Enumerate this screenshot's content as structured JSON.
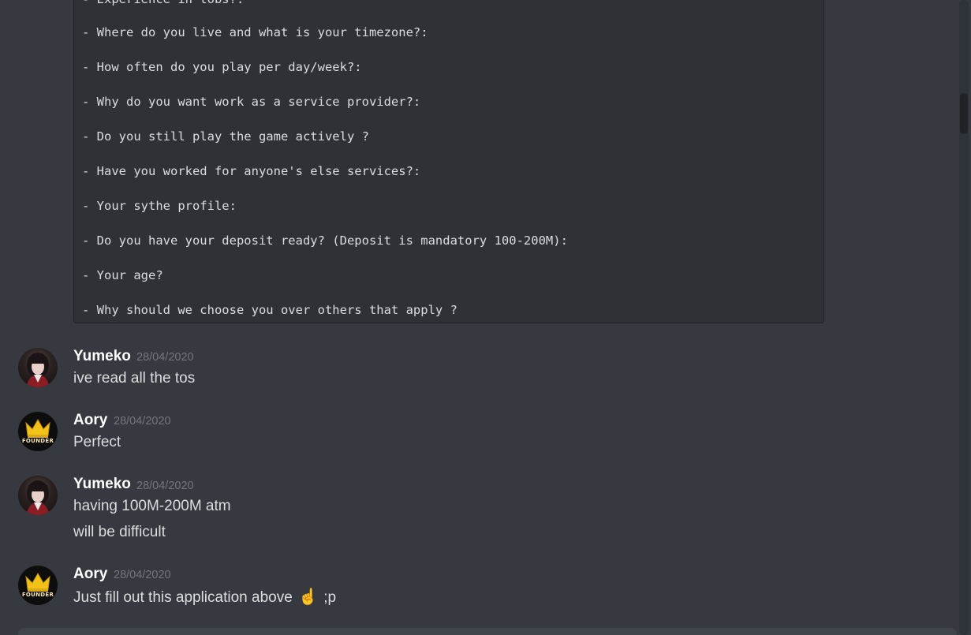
{
  "codeblock": {
    "lines": [
      "- Experience in tobs?:",
      "- Where do you live and what is your timezone?:",
      "- How often do you play per day/week?:",
      "- Why do you want work as a service provider?:",
      "- Do you still play the game actively ?",
      "- Have you worked for anyone's else services?:",
      "- Your sythe profile:",
      "- Do you have your deposit ready? (Deposit is mandatory 100-200M):",
      "- Your age?",
      "- Why should we choose you over others that apply ?"
    ]
  },
  "messages": [
    {
      "author": "Yumeko",
      "timestamp": "28/04/2020",
      "avatar": "yumeko-avatar",
      "lines": [
        "ive read all the tos"
      ]
    },
    {
      "author": "Aory",
      "timestamp": "28/04/2020",
      "avatar": "founder-crown-avatar",
      "lines": [
        "Perfect"
      ]
    },
    {
      "author": "Yumeko",
      "timestamp": "28/04/2020",
      "avatar": "yumeko-avatar",
      "lines": [
        "having 100M-200M atm",
        "will be difficult"
      ]
    },
    {
      "author": "Aory",
      "timestamp": "28/04/2020",
      "avatar": "founder-crown-avatar",
      "lines": [
        "Just fill out this application above",
        ";p"
      ],
      "emoji": "☝"
    }
  ],
  "avatar_badge_text": "FOUNDER",
  "colors": {
    "background": "#36393f",
    "codeblock_bg": "#2f3136",
    "username": "#ffffff",
    "text": "#dcddde",
    "timestamp": "#72767d",
    "crown": "#f2c21a"
  }
}
